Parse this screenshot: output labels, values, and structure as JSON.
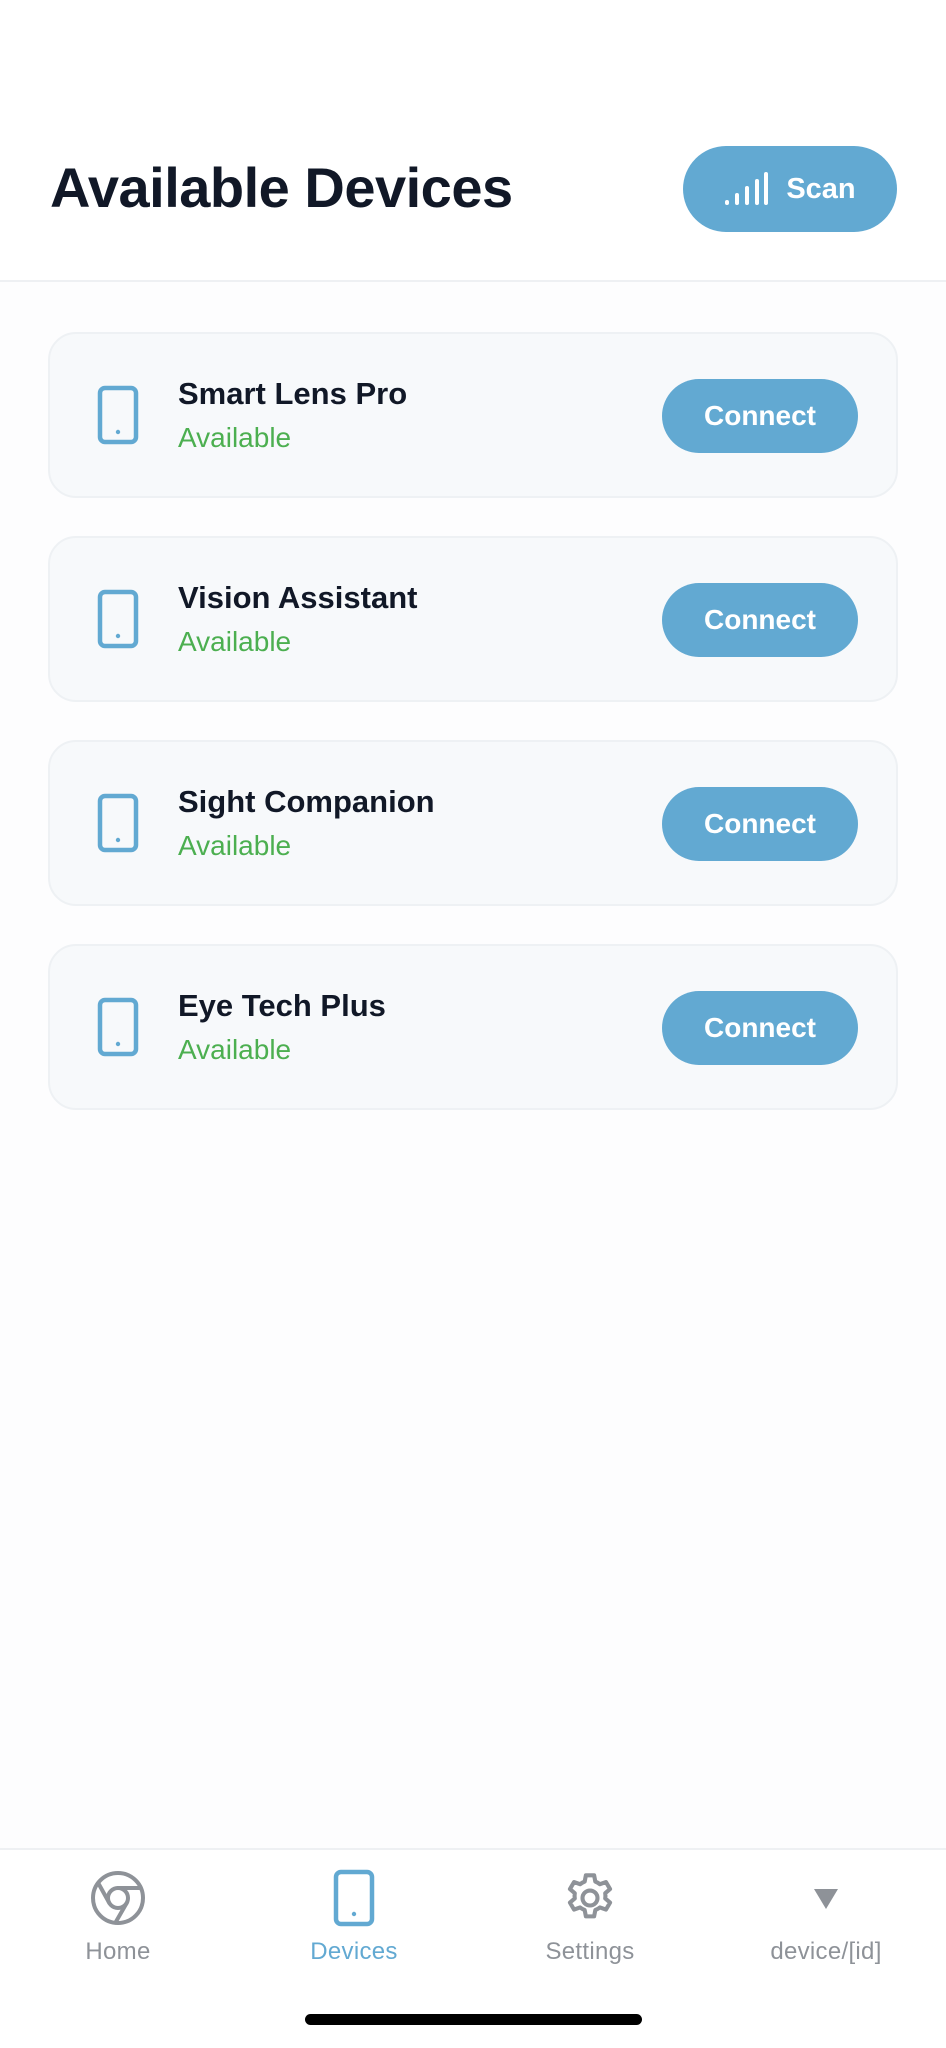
{
  "header": {
    "title": "Available Devices",
    "scan_label": "Scan",
    "scan_icon": "signal-bars-icon"
  },
  "devices": [
    {
      "name": "Smart Lens Pro",
      "status": "Available",
      "action": "Connect",
      "icon": "tablet-icon"
    },
    {
      "name": "Vision Assistant",
      "status": "Available",
      "action": "Connect",
      "icon": "tablet-icon"
    },
    {
      "name": "Sight Companion",
      "status": "Available",
      "action": "Connect",
      "icon": "tablet-icon"
    },
    {
      "name": "Eye Tech Plus",
      "status": "Available",
      "action": "Connect",
      "icon": "tablet-icon"
    }
  ],
  "tabs": [
    {
      "label": "Home",
      "icon": "chrome-icon",
      "active": false
    },
    {
      "label": "Devices",
      "icon": "tablet-icon",
      "active": true
    },
    {
      "label": "Settings",
      "icon": "gear-icon",
      "active": false
    },
    {
      "label": "device/[id]",
      "icon": "triangle-down-icon",
      "active": false
    }
  ],
  "colors": {
    "accent": "#62a9d2",
    "status_available": "#4caf50",
    "title": "#111827",
    "tab_inactive": "#8e9298",
    "card_background": "#f7f9fb"
  }
}
